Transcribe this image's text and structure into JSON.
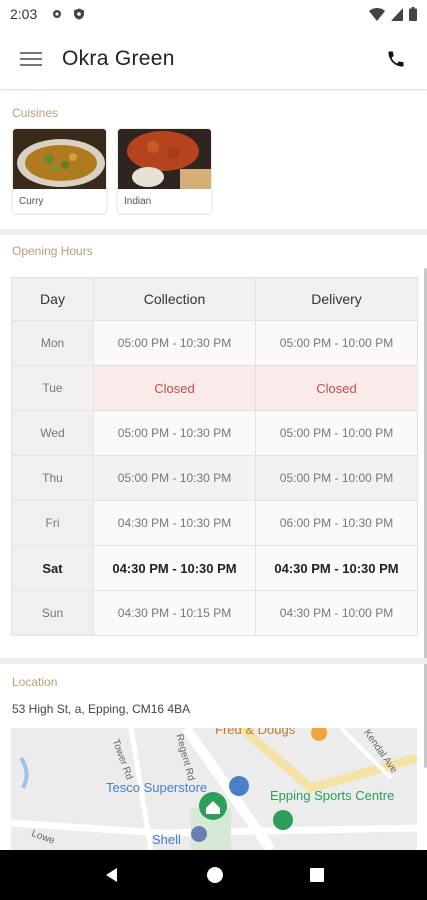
{
  "status_bar": {
    "time": "2:03"
  },
  "app_bar": {
    "title": "Okra Green"
  },
  "cuisines": {
    "label": "Cuisines",
    "items": [
      {
        "label": "Curry"
      },
      {
        "label": "Indian"
      }
    ]
  },
  "opening_hours": {
    "label": "Opening Hours",
    "headers": [
      "Day",
      "Collection",
      "Delivery"
    ],
    "rows": [
      {
        "day": "Mon",
        "collection": "05:00 PM - 10:30 PM",
        "delivery": "05:00 PM - 10:00 PM"
      },
      {
        "day": "Tue",
        "collection": "Closed",
        "delivery": "Closed"
      },
      {
        "day": "Wed",
        "collection": "05:00 PM - 10:30 PM",
        "delivery": "05:00 PM - 10:00 PM"
      },
      {
        "day": "Thu",
        "collection": "05:00 PM - 10:30 PM",
        "delivery": "05:00 PM - 10:00 PM"
      },
      {
        "day": "Fri",
        "collection": "04:30 PM - 10:30 PM",
        "delivery": "06:00 PM - 10:30 PM"
      },
      {
        "day": "Sat",
        "collection": "04:30 PM - 10:30 PM",
        "delivery": "04:30 PM - 10:30 PM"
      },
      {
        "day": "Sun",
        "collection": "04:30 PM - 10:15 PM",
        "delivery": "04:30 PM - 10:00 PM"
      }
    ]
  },
  "location": {
    "label": "Location",
    "address": "53 High St, a, Epping, CM16 4BA",
    "map_labels": {
      "fred_dougs": "Fred & Dougs",
      "tesco": "Tesco Superstore",
      "epping_sports": "Epping Sports Centre",
      "shell": "Shell",
      "tower_rd": "Tower Rd",
      "regent_rd": "Regent Rd",
      "kendal_ave": "Kendal Ave",
      "lower": "Lowe"
    }
  },
  "colors": {
    "accent_label": "#b79f7a",
    "closed_text": "#c0504d",
    "closed_bg": "#fbeaea",
    "map_green": "#2e9e5b",
    "map_blue": "#4a80c8"
  }
}
